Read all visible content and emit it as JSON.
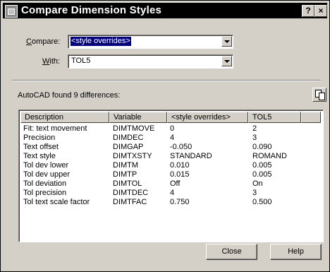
{
  "window": {
    "title": "Compare Dimension Styles",
    "help_label": "?",
    "close_label": "×"
  },
  "compare": {
    "label_key": "C",
    "label_rest": "ompare:",
    "value": "<style overrides>"
  },
  "with": {
    "label_key": "W",
    "label_rest": "ith:",
    "value": "TOL5"
  },
  "summary": "AutoCAD found 9 differences:",
  "columns": [
    "Description",
    "Variable",
    "<style overrides>",
    "TOL5"
  ],
  "rows": [
    [
      "Fit: text movement",
      "DIMTMOVE",
      "0",
      "2"
    ],
    [
      "Precision",
      "DIMDEC",
      "4",
      "3"
    ],
    [
      "Text offset",
      "DIMGAP",
      "-0.050",
      "0.090"
    ],
    [
      "Text style",
      "DIMTXSTY",
      "STANDARD",
      "ROMAND"
    ],
    [
      "Tol dev lower",
      "DIMTM",
      "0.010",
      "0.005"
    ],
    [
      "Tol dev upper",
      "DIMTP",
      "0.015",
      "0.005"
    ],
    [
      "Tol deviation",
      "DIMTOL",
      "Off",
      "On"
    ],
    [
      "Tol precision",
      "DIMTDEC",
      "4",
      "3"
    ],
    [
      "Tol text scale factor",
      "DIMTFAC",
      "0.750",
      "0.500"
    ]
  ],
  "buttons": {
    "close": "Close",
    "help": "Help"
  },
  "icons": {
    "title": "app-icon",
    "copy": "copy-to-clipboard-icon"
  }
}
